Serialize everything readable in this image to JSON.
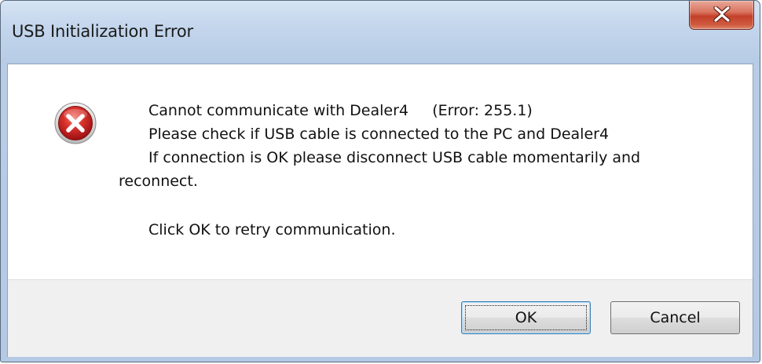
{
  "window": {
    "title": "USB Initialization Error",
    "close_icon": "close-icon"
  },
  "message": {
    "icon": "error-icon",
    "line1": "Cannot communicate with Dealer4     (Error: 255.1)",
    "line2": "Please check if USB cable is connected to the PC and Dealer4",
    "line3": "If connection is OK please disconnect USB cable momentarily and",
    "line4": "reconnect.",
    "line5": "Click OK to retry communication."
  },
  "buttons": {
    "ok_label": "OK",
    "cancel_label": "Cancel"
  },
  "colors": {
    "error_red": "#c8202a",
    "close_red": "#c3402a",
    "titlebar_blue": "#b9cde7"
  }
}
